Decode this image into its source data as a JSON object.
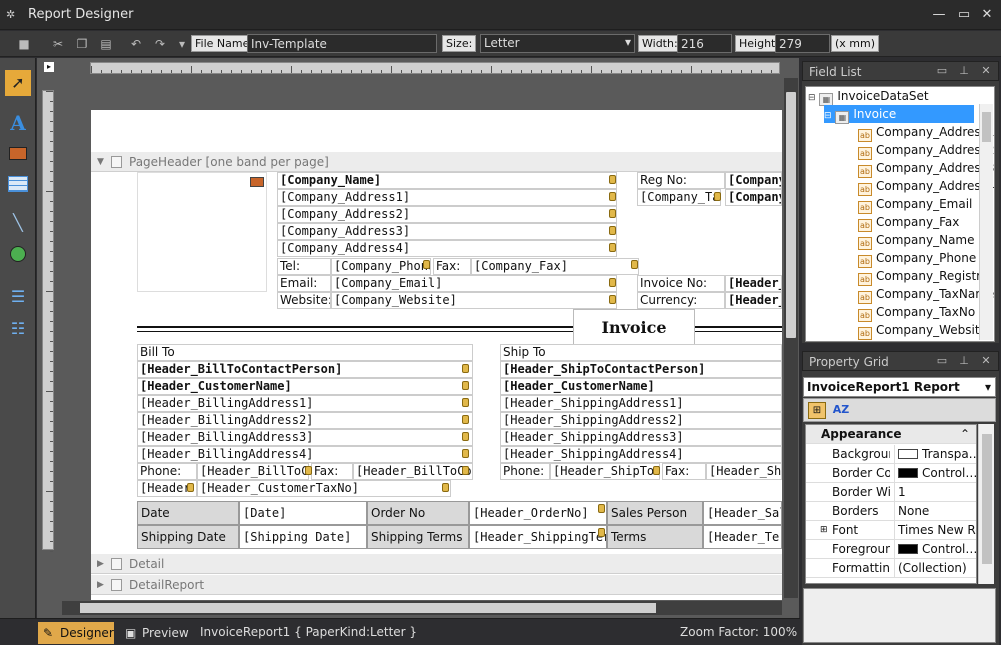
{
  "window": {
    "title": "Report Designer"
  },
  "toolbar": {
    "file_name_label": "File Name:",
    "file_name": "Inv-Template",
    "size_label": "Size:",
    "size": "Letter",
    "width_label": "Width:",
    "width": "216",
    "height_label": "Height:",
    "height": "279",
    "units": "(x mm)"
  },
  "bands": {
    "page_header": "PageHeader [one band per page]",
    "detail": "Detail",
    "detail_report": "DetailReport"
  },
  "company": {
    "name": "[Company_Name]",
    "addr1": "[Company_Address1]",
    "addr2": "[Company_Address2]",
    "addr3": "[Company_Address3]",
    "addr4": "[Company_Address4]",
    "tel_label": "Tel:",
    "tel": "[Company_Phone]",
    "fax_label": "Fax:",
    "fax": "[Company_Fax]",
    "email_label": "Email:",
    "email": "[Company_Email]",
    "website_label": "Website:",
    "website": "[Company_Website]",
    "reg_label": "Reg No:",
    "reg": "[Company",
    "taxlabel": "[Company_Ta",
    "tax": "[Company"
  },
  "invoice_info": {
    "invoice_no_label": "Invoice No:",
    "invoice_no": "[Header_",
    "currency_label": "Currency:",
    "currency": "[Header_",
    "title": "Invoice"
  },
  "bill_to": {
    "title": "Bill To",
    "contact": "[Header_BillToContactPerson]",
    "customer": "[Header_CustomerName]",
    "a1": "[Header_BillingAddress1]",
    "a2": "[Header_BillingAddress2]",
    "a3": "[Header_BillingAddress3]",
    "a4": "[Header_BillingAddress4]",
    "phone_label": "Phone:",
    "phone": "[Header_BillToCo",
    "fax_label": "Fax:",
    "fax": "[Header_BillToCon",
    "taxno_label": "[Header",
    "taxno": "[Header_CustomerTaxNo]"
  },
  "ship_to": {
    "title": "Ship To",
    "contact": "[Header_ShipToContactPerson]",
    "customer": "[Header_CustomerName]",
    "a1": "[Header_ShippingAddress1]",
    "a2": "[Header_ShippingAddress2]",
    "a3": "[Header_ShippingAddress3]",
    "a4": "[Header_ShippingAddress4]",
    "phone_label": "Phone:",
    "phone": "[Header_ShipToC",
    "fax_label": "Fax:",
    "fax": "[Header_Ship"
  },
  "grid": {
    "r1": [
      "Date",
      "[Date]",
      "Order No",
      "[Header_OrderNo]",
      "Sales Person",
      "[Header_Sale"
    ],
    "r2": [
      "Shipping Date",
      "[Shipping Date]",
      "Shipping Terms",
      "[Header_ShippingTerm",
      "Terms",
      "[Header_Terr"
    ]
  },
  "status": {
    "designer": "Designer",
    "preview": "Preview",
    "info": "InvoiceReport1 { PaperKind:Letter }",
    "zoom": "Zoom Factor: 100%"
  },
  "field_list": {
    "title": "Field List",
    "root": "InvoiceDataSet",
    "table": "Invoice",
    "fields": [
      "Company_Address1",
      "Company_Address2",
      "Company_Address3",
      "Company_Address4",
      "Company_Email",
      "Company_Fax",
      "Company_Name",
      "Company_Phone",
      "Company_Registr…",
      "Company_TaxName",
      "Company_TaxNo",
      "Company_Website"
    ]
  },
  "property_grid": {
    "title": "Property Grid",
    "object": "InvoiceReport1   Report",
    "category": "Appearance",
    "rows": [
      {
        "k": "Background",
        "v": "Transpa…",
        "swatch": "#ffffff"
      },
      {
        "k": "Border Colo",
        "v": "Control…",
        "swatch": "#000000"
      },
      {
        "k": "Border Widt",
        "v": "1"
      },
      {
        "k": "Borders",
        "v": "None"
      },
      {
        "k": "Font",
        "v": "Times New Ro…"
      },
      {
        "k": "Foreground",
        "v": "Control…",
        "swatch": "#000000"
      },
      {
        "k": "Formatting I",
        "v": "(Collection)"
      }
    ]
  }
}
